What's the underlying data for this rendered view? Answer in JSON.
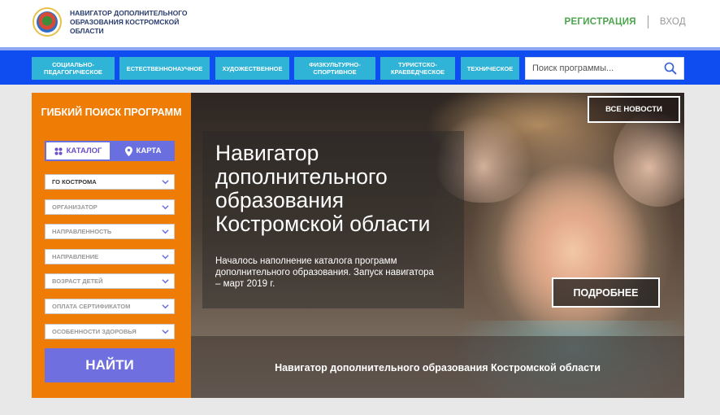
{
  "header": {
    "brand": "НАВИГАТОР ДОПОЛНИТЕЛЬНОГО ОБРАЗОВАНИЯ КОСТРОМСКОЙ ОБЛАСТИ",
    "register_label": "РЕГИСТРАЦИЯ",
    "login_label": "ВХОД"
  },
  "nav": {
    "tabs": [
      {
        "label": "СОЦИАЛЬНО-ПЕДАГОГИЧЕСКОЕ"
      },
      {
        "label": "ЕСТЕСТВЕННОНАУЧНОЕ"
      },
      {
        "label": "ХУДОЖЕСТВЕННОЕ"
      },
      {
        "label": "ФИЗКУЛЬТУРНО-СПОРТИВНОЕ"
      },
      {
        "label": "ТУРИСТСКО-КРАЕВЕДЧЕСКОЕ"
      },
      {
        "label": "ТЕХНИЧЕСКОЕ"
      }
    ],
    "search_placeholder": "Поиск программы..."
  },
  "filter": {
    "title": "ГИБКИЙ ПОИСК ПРОГРАММ",
    "catalog_label": "КАТАЛОГ",
    "map_label": "КАРТА",
    "selects": [
      {
        "label": "ГО КОСТРОМА"
      },
      {
        "label": "ОРГАНИЗАТОР"
      },
      {
        "label": "НАПРАВЛЕННОСТЬ"
      },
      {
        "label": "НАПРАВЛЕНИЕ"
      },
      {
        "label": "ВОЗРАСТ ДЕТЕЙ"
      },
      {
        "label": "ОПЛАТА СЕРТИФИКАТОМ"
      },
      {
        "label": "ОСОБЕННОСТИ ЗДОРОВЬЯ"
      }
    ],
    "find_label": "НАЙТИ"
  },
  "hero": {
    "title": "Навигатор дополнительного образования Костромской области",
    "description": "Началось наполнение каталога программ дополнительного образования. Запуск навигатора – март 2019 г.",
    "all_news_label": "ВСЕ НОВОСТИ",
    "more_label": "ПОДРОБНЕЕ",
    "strip_text": "Навигатор дополнительного образования Костромской области"
  },
  "colors": {
    "nav_bg": "#0f4df0",
    "tab_bg": "#2fb3d6",
    "filter_bg": "#ef7d05",
    "accent_purple": "#6f6fe0",
    "register_green": "#4aa54a"
  }
}
